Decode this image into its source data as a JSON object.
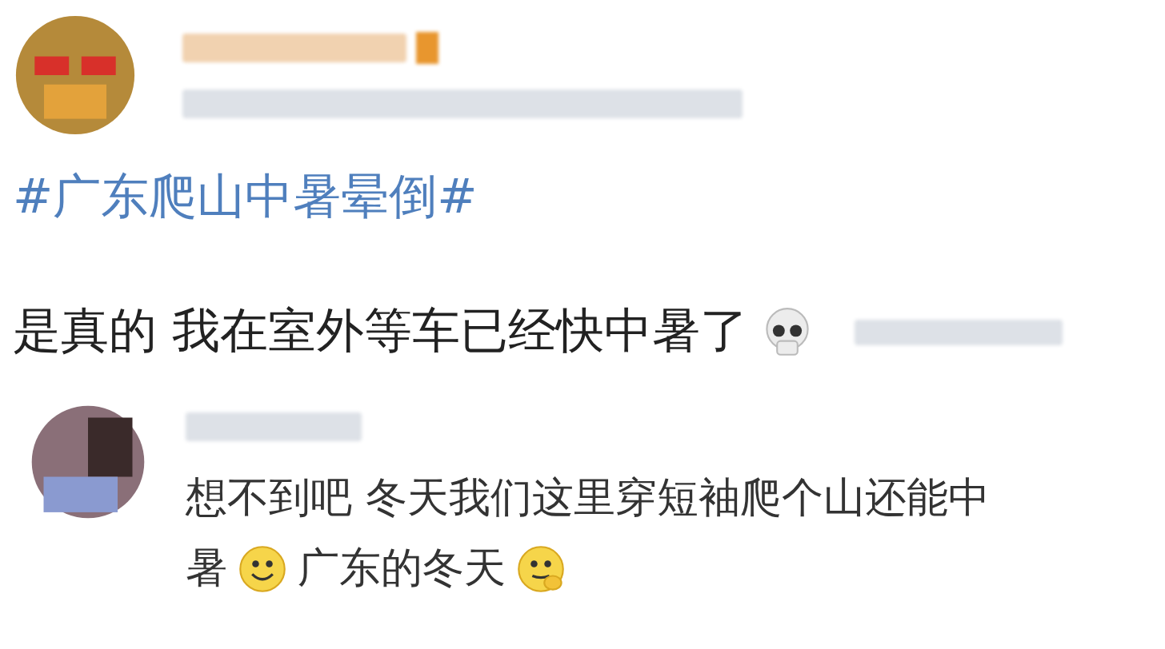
{
  "post": {
    "hashtag": "#广东爬山中暑晕倒#",
    "text": "是真的 我在室外等车已经快中暑了"
  },
  "comment": {
    "text_line_1": "想不到吧 冬天我们这里穿短袖爬个山还能中",
    "text_line_2_a": "暑",
    "text_line_2_b": "广东的冬天"
  }
}
